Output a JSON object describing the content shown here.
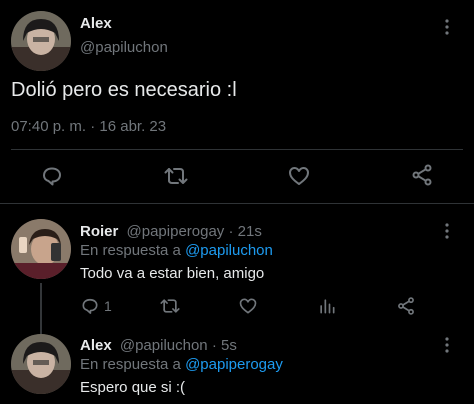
{
  "main_tweet": {
    "display_name": "Alex",
    "handle": "@papiluchon",
    "text": "Dolió pero es necesario :l",
    "timestamp": "07:40 p. m. · 16 abr. 23",
    "icons": [
      "reply-icon",
      "retweet-icon",
      "like-icon",
      "share-icon"
    ]
  },
  "reply_1": {
    "display_name": "Roier",
    "handle": "@papiperogay",
    "time": "· 21s",
    "in_reply_prefix": "En respuesta a ",
    "in_reply_handle": "@papiluchon",
    "text": "Todo va a estar bien, amigo",
    "reply_count": "1"
  },
  "reply_2": {
    "display_name": "Alex",
    "handle": "@papiluchon",
    "time": "· 5s",
    "in_reply_prefix": "En respuesta a ",
    "in_reply_handle": "@papiperogay",
    "text": "Espero que si :("
  },
  "colors": {
    "background": "#000000",
    "text": "#e7e9ea",
    "muted": "#71767b",
    "link": "#1d9bf0",
    "divider": "#2f3336"
  }
}
